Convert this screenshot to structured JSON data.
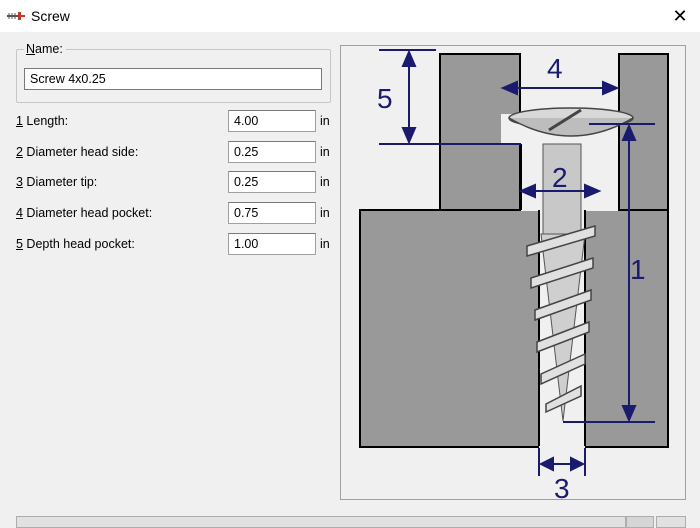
{
  "window": {
    "title": "Screw",
    "close_symbol": "✕",
    "icon": "screw-app-icon"
  },
  "name_group": {
    "label_accel": "N",
    "label_rest": "ame:",
    "value": "Screw 4x0.25"
  },
  "params": [
    {
      "accel": "1",
      "label": " Length:",
      "value": "4.00",
      "unit": "in"
    },
    {
      "accel": "2",
      "label": " Diameter head side:",
      "value": "0.25",
      "unit": "in"
    },
    {
      "accel": "3",
      "label": " Diameter tip:",
      "value": "0.25",
      "unit": "in"
    },
    {
      "accel": "4",
      "label": " Diameter head pocket:",
      "value": "0.75",
      "unit": "in"
    },
    {
      "accel": "5",
      "label": " Depth head pocket:",
      "value": "1.00",
      "unit": "in"
    }
  ],
  "diagram": {
    "dimension_labels": [
      "1",
      "2",
      "3",
      "4",
      "5"
    ],
    "colors": {
      "block": "#999999",
      "block_outline": "#000000",
      "dimension": "#1a1a6e",
      "screw": "#cfcfcf"
    }
  }
}
